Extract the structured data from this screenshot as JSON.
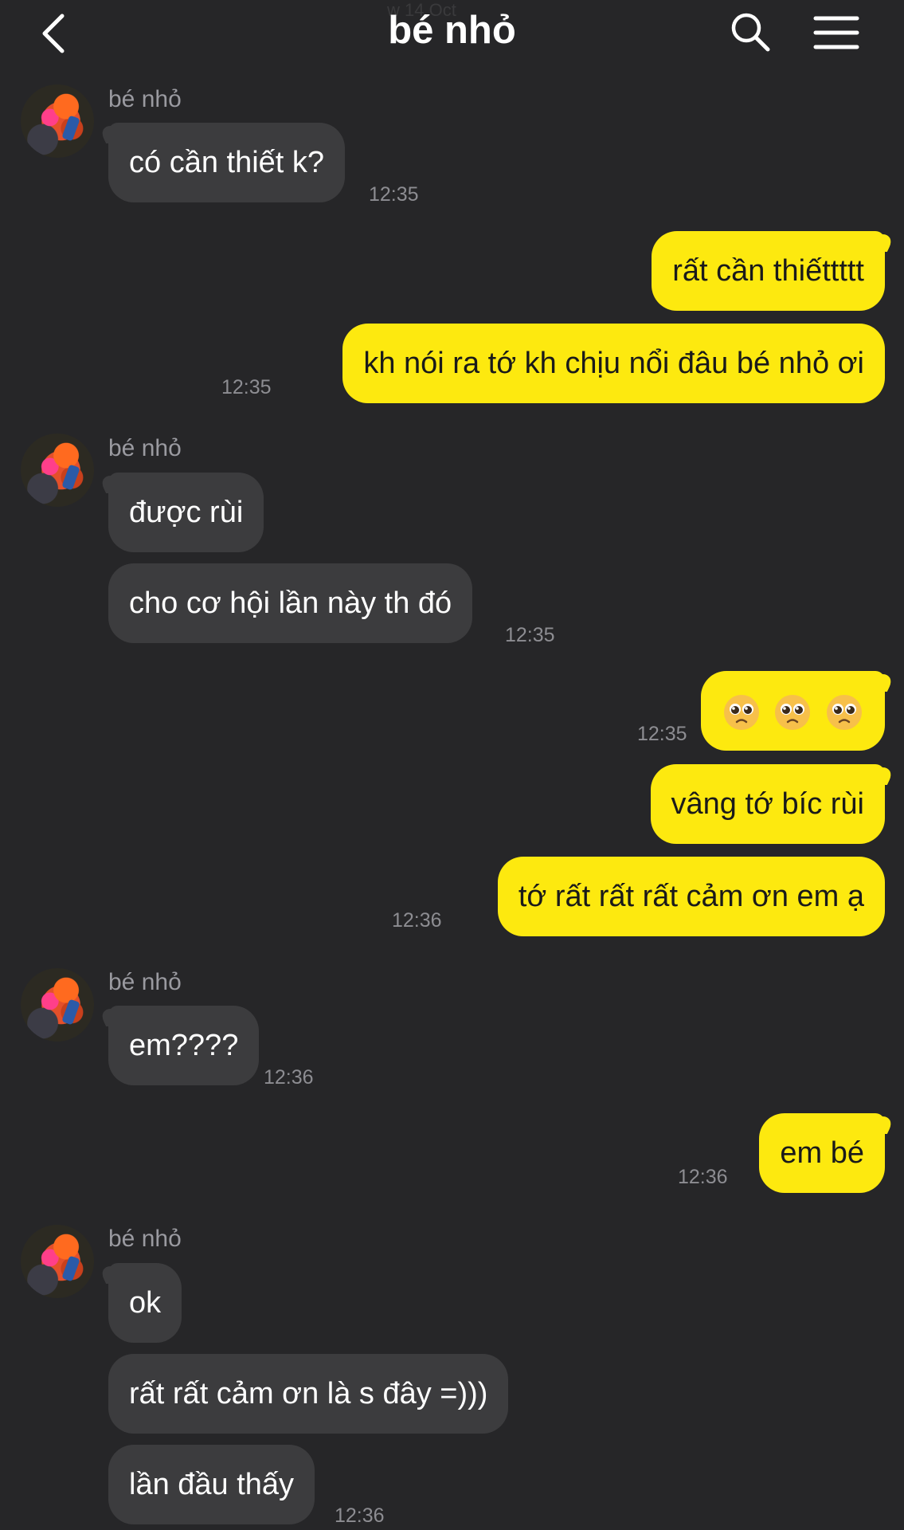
{
  "header": {
    "title": "bé nhỏ",
    "date_ghost": "w 14 Oct",
    "back_icon": "chevron-left-icon",
    "search_icon": "search-icon",
    "menu_icon": "hamburger-menu-icon"
  },
  "colors": {
    "background": "#262628",
    "incoming_bubble": "#3c3c3e",
    "outgoing_bubble": "#fde90f",
    "timestamp": "#8d8d92",
    "sender_name": "#9a9aa0"
  },
  "messages": [
    {
      "sender": "bé nhỏ",
      "text": "có cần thiết k?",
      "time": "12:35"
    },
    {
      "text": "rất cần thiếttttt"
    },
    {
      "text": "kh nói ra tớ kh chịu nổi đâu bé nhỏ ơi",
      "time": "12:35"
    },
    {
      "sender": "bé nhỏ",
      "text": "được rùi"
    },
    {
      "text": "cho cơ hội lần này th đó",
      "time": "12:35"
    },
    {
      "text": "pleading-face pleading-face pleading-face",
      "time": "12:35"
    },
    {
      "text": "vâng tớ bíc rùi"
    },
    {
      "text": "tớ rất rất rất cảm ơn em ạ",
      "time": "12:36"
    },
    {
      "sender": "bé nhỏ",
      "text": "em????",
      "time": "12:36"
    },
    {
      "text": "em bé",
      "time": "12:36"
    },
    {
      "sender": "bé nhỏ",
      "text": "ok"
    },
    {
      "text": "rất rất cảm ơn là s đây =)))"
    },
    {
      "text": "lần đầu thấy",
      "time": "12:36"
    }
  ]
}
